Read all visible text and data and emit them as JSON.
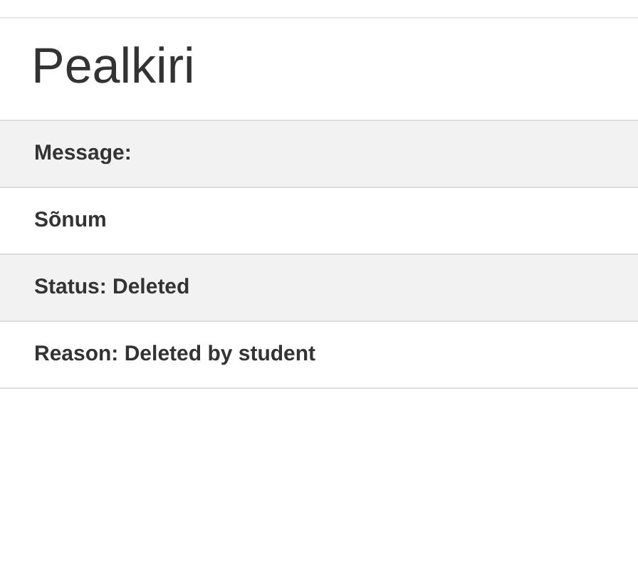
{
  "title": "Pealkiri",
  "rows": [
    "Message:",
    "Sõnum",
    "Status: Deleted",
    "Reason: Deleted by student"
  ]
}
